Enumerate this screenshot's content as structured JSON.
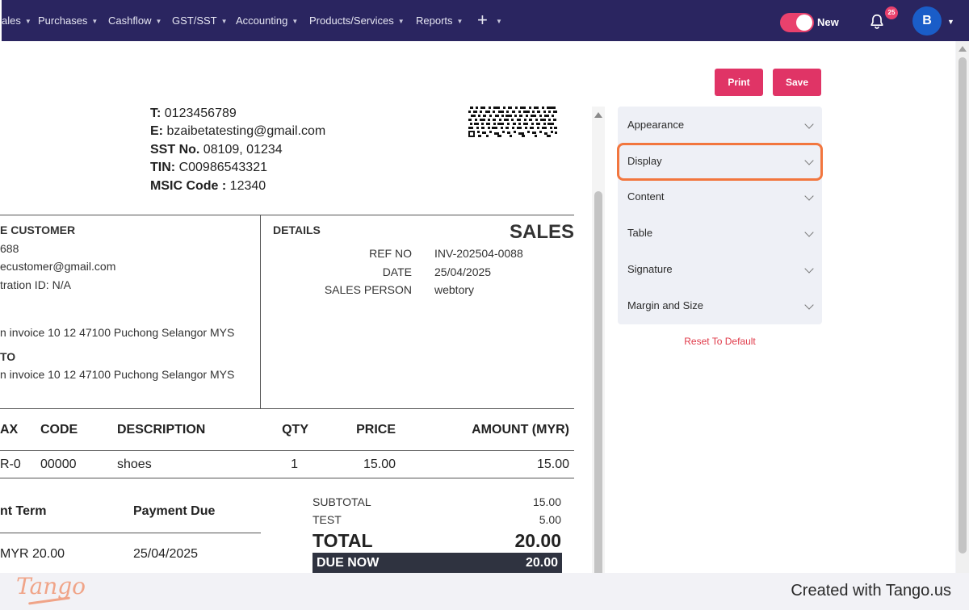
{
  "nav": {
    "items": [
      "ales",
      "Purchases",
      "Cashflow",
      "GST/SST",
      "Accounting",
      "Products/Services",
      "Reports"
    ],
    "plus_symbol": "+",
    "toggle_label": "New",
    "notification_count": "25",
    "avatar_initial": "B"
  },
  "actions": {
    "print": "Print",
    "save": "Save"
  },
  "invoice": {
    "contact": {
      "phone_label": "T:",
      "phone": "0123456789",
      "email_label": "E:",
      "email": "bzaibetatesting@gmail.com",
      "sst_label": "SST No.",
      "sst": "08109, 01234",
      "tin_label": "TIN:",
      "tin": "C00986543321",
      "msic_label": "MSIC Code :",
      "msic": "12340"
    },
    "customer": {
      "heading": "E CUSTOMER",
      "phone": "688",
      "email": "ecustomer@gmail.com",
      "registration": "tration ID: N/A",
      "billing_address": "n invoice 10 12 47100 Puchong Selangor MYS",
      "ship_heading": "TO",
      "shipping_address": "n invoice 10 12 47100 Puchong Selangor MYS"
    },
    "details": {
      "heading": "DETAILS",
      "doc_title": "SALES",
      "rows": [
        {
          "label": "REF NO",
          "value": "INV-202504-0088"
        },
        {
          "label": "DATE",
          "value": "25/04/2025"
        },
        {
          "label": "SALES PERSON",
          "value": "webtory"
        }
      ]
    },
    "table": {
      "headers": [
        "AX",
        "CODE",
        "DESCRIPTION",
        "QTY",
        "PRICE",
        "AMOUNT (MYR)"
      ],
      "rows": [
        [
          "R-0",
          "00000",
          "shoes",
          "1",
          "15.00",
          "15.00"
        ]
      ]
    },
    "payment": {
      "headers": [
        "nt Term",
        "Payment Due"
      ],
      "row": [
        "MYR 20.00",
        "25/04/2025"
      ]
    },
    "totals": {
      "subtotal_label": "SUBTOTAL",
      "subtotal": "15.00",
      "test_label": "TEST",
      "test": "5.00",
      "total_label": "TOTAL",
      "total": "20.00",
      "due_label": "DUE NOW",
      "due": "20.00"
    }
  },
  "settings": {
    "sections": [
      "Appearance",
      "Display",
      "Content",
      "Table",
      "Signature",
      "Margin and Size"
    ],
    "highlighted": "Display",
    "reset_label": "Reset To Default"
  },
  "footer": {
    "logo": "Tango",
    "created": "Created with Tango.us"
  },
  "colors": {
    "nav_bg": "#2a2560",
    "accent": "#e03466",
    "highlight": "#f2763e",
    "avatar": "#1a5dc8"
  }
}
